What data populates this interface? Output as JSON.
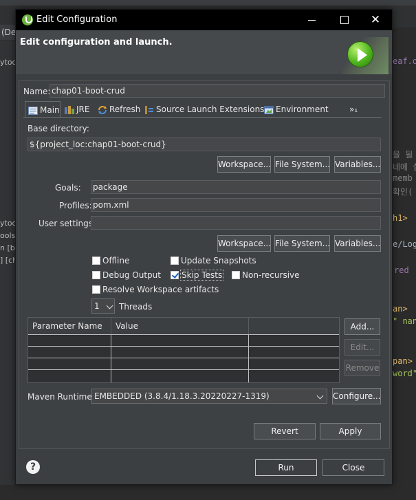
{
  "ide": {
    "tab_label": "(De",
    "left_lines": [
      "ytoo",
      "ytoo",
      "ools]",
      "n [bo",
      "] [ch"
    ],
    "right_lines": [
      {
        "text": "eaf.o",
        "color": "#9876aa"
      },
      {
        "text": "을 될",
        "color": "#808080"
      },
      {
        "text": "네에 실",
        "color": "#808080"
      },
      {
        "text": "memb",
        "color": "#808080"
      },
      {
        "text": "확인(",
        "color": "#808080"
      },
      {
        "text": "h1>",
        "color": "#e8bf6a"
      },
      {
        "text": "e/Log",
        "color": "#a9b7c6"
      },
      {
        "text": "red",
        "color": "#9876aa"
      },
      {
        "text": "an>",
        "color": "#e8bf6a"
      },
      {
        "text": "\" nan",
        "color": "#a5c25c"
      },
      {
        "text": "pan>",
        "color": "#e8bf6a"
      },
      {
        "text": "word\"",
        "color": "#a5c25c"
      }
    ]
  },
  "dialog": {
    "title": "Edit Configuration",
    "header_title": "Edit configuration and launch.",
    "name_label": "Name:",
    "name_value": "chap01-boot-crud",
    "tabs": [
      {
        "label": "Main",
        "icon": "main-tab-icon"
      },
      {
        "label": "JRE",
        "icon": "jre-tab-icon"
      },
      {
        "label": "Refresh",
        "icon": "refresh-tab-icon"
      },
      {
        "label": "Source",
        "icon": "source-tab-icon"
      },
      {
        "label": "Launch Extensions",
        "icon": ""
      },
      {
        "label": "Environment",
        "icon": "environment-tab-icon"
      },
      {
        "label": "»₁",
        "icon": ""
      }
    ],
    "base_directory_label": "Base directory:",
    "base_directory_value": "${project_loc:chap01-boot-crud}",
    "workspace_btn": "Workspace...",
    "filesystem_btn": "File System...",
    "variables_btn": "Variables...",
    "goals_label": "Goals:",
    "goals_value": "package",
    "profiles_label": "Profiles:",
    "profiles_value": "pom.xml",
    "user_settings_label": "User settings:",
    "user_settings_value": "",
    "checkboxes": {
      "offline": {
        "label": "Offline",
        "checked": false
      },
      "update_snapshots": {
        "label": "Update Snapshots",
        "checked": false
      },
      "debug_output": {
        "label": "Debug Output",
        "checked": false
      },
      "skip_tests": {
        "label": "Skip Tests",
        "checked": true
      },
      "non_recursive": {
        "label": "Non-recursive",
        "checked": false
      },
      "resolve_workspace": {
        "label": "Resolve Workspace artifacts",
        "checked": false
      }
    },
    "threads_value": "1",
    "threads_label": "Threads",
    "param_table": {
      "columns": [
        "Parameter Name",
        "Value",
        ""
      ],
      "rows": []
    },
    "add_btn": "Add...",
    "edit_btn": "Edit...",
    "remove_btn": "Remove",
    "maven_runtime_label": "Maven Runtime:",
    "maven_runtime_value": "EMBEDDED (3.8.4/1.18.3.20220227-1319)",
    "configure_btn": "Configure...",
    "revert_btn": "Revert",
    "apply_btn": "Apply",
    "run_btn": "Run",
    "close_btn": "Close",
    "help_symbol": "?"
  }
}
